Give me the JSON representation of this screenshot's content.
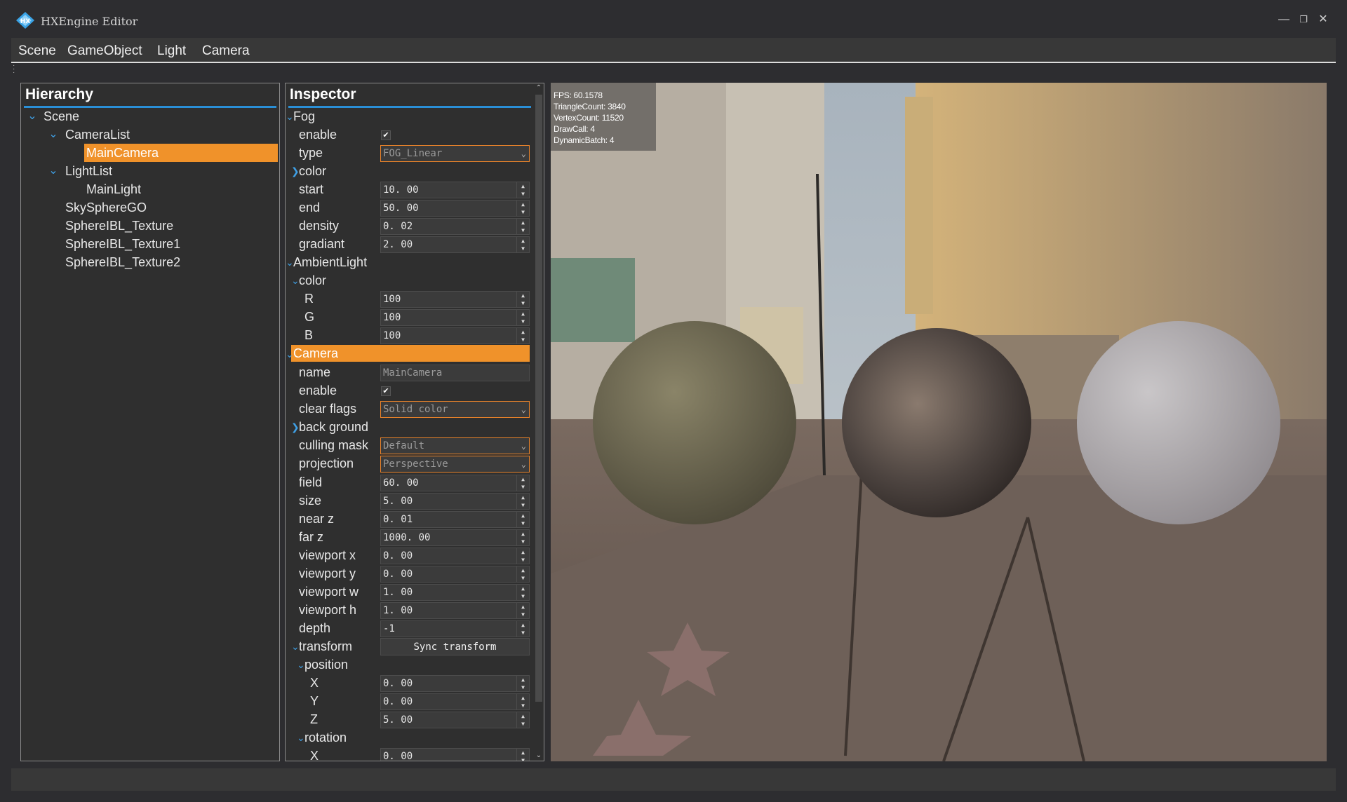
{
  "window": {
    "title": "HXEngine Editor"
  },
  "menu": [
    "Scene",
    "GameObject",
    "Light",
    "Camera"
  ],
  "hierarchy": {
    "title": "Hierarchy",
    "items": [
      {
        "label": "Scene"
      },
      {
        "label": "CameraList"
      },
      {
        "label": "MainCamera",
        "selected": true
      },
      {
        "label": "LightList"
      },
      {
        "label": "MainLight"
      },
      {
        "label": "SkySphereGO"
      },
      {
        "label": "SphereIBL_Texture"
      },
      {
        "label": "SphereIBL_Texture1"
      },
      {
        "label": "SphereIBL_Texture2"
      }
    ]
  },
  "inspector": {
    "title": "Inspector",
    "fog": {
      "label": "Fog",
      "enable": {
        "label": "enable",
        "checked": true
      },
      "type": {
        "label": "type",
        "value": "FOG_Linear"
      },
      "color": {
        "label": "color"
      },
      "start": {
        "label": "start",
        "value": "10. 00"
      },
      "end": {
        "label": "end",
        "value": "50. 00"
      },
      "density": {
        "label": "density",
        "value": "0. 02"
      },
      "gradiant": {
        "label": "gradiant",
        "value": "2. 00"
      }
    },
    "ambient": {
      "label": "AmbientLight",
      "color": {
        "label": "color"
      },
      "r": {
        "label": "R",
        "value": "100"
      },
      "g": {
        "label": "G",
        "value": "100"
      },
      "b": {
        "label": "B",
        "value": "100"
      }
    },
    "camera": {
      "label": "Camera",
      "name": {
        "label": "name",
        "value": "MainCamera"
      },
      "enable": {
        "label": "enable",
        "checked": true
      },
      "clear_flags": {
        "label": "clear flags",
        "value": "Solid color"
      },
      "background": {
        "label": "back ground"
      },
      "culling_mask": {
        "label": "culling mask",
        "value": "Default"
      },
      "projection": {
        "label": "projection",
        "value": "Perspective"
      },
      "field": {
        "label": "field",
        "value": "60. 00"
      },
      "size": {
        "label": "size",
        "value": "5. 00"
      },
      "near_z": {
        "label": "near z",
        "value": "0. 01"
      },
      "far_z": {
        "label": "far z",
        "value": "1000. 00"
      },
      "viewport_x": {
        "label": "viewport x",
        "value": "0. 00"
      },
      "viewport_y": {
        "label": "viewport y",
        "value": "0. 00"
      },
      "viewport_w": {
        "label": "viewport w",
        "value": "1. 00"
      },
      "viewport_h": {
        "label": "viewport h",
        "value": "1. 00"
      },
      "depth": {
        "label": "depth",
        "value": "-1"
      }
    },
    "transform": {
      "label": "transform",
      "sync_button": "Sync transform",
      "position": {
        "label": "position",
        "x": {
          "label": "X",
          "value": "0. 00"
        },
        "y": {
          "label": "Y",
          "value": "0. 00"
        },
        "z": {
          "label": "Z",
          "value": "5. 00"
        }
      },
      "rotation": {
        "label": "rotation",
        "x": {
          "label": "X",
          "value": "0. 00"
        }
      }
    }
  },
  "stats": {
    "fps": "FPS: 60.1578",
    "triangles": "TriangleCount: 3840",
    "vertices": "VertexCount: 11520",
    "drawcalls": "DrawCall: 4",
    "batches": "DynamicBatch: 4"
  },
  "colors": {
    "accent_selected": "#f0922a",
    "accent_blue": "#2a8fd6",
    "combo_border": "#e8822a"
  },
  "icons": [
    "app-logo-icon",
    "minimize-icon",
    "restore-icon",
    "close-icon",
    "chevron-down-icon",
    "chevron-right-icon",
    "checkmark-icon",
    "spin-up-icon",
    "spin-down-icon"
  ]
}
